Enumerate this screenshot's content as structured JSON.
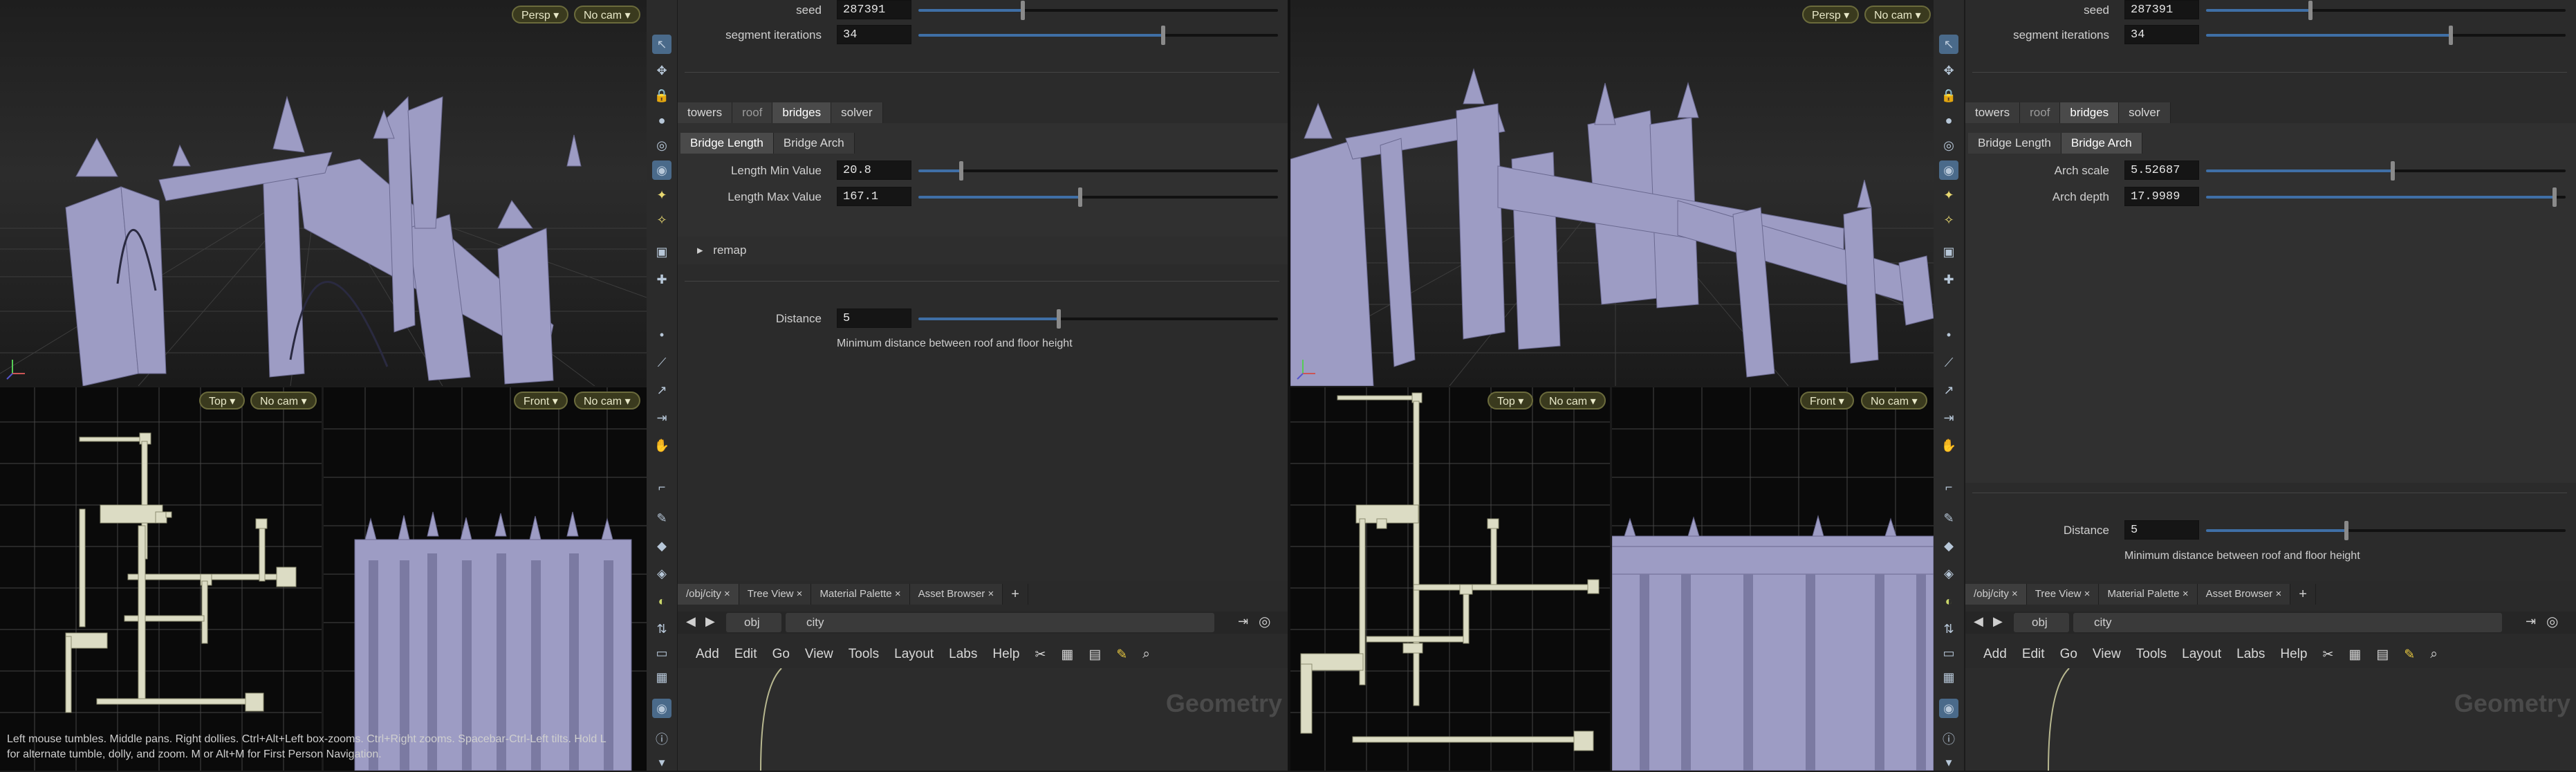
{
  "left": {
    "viewport_persp": {
      "view": "Persp",
      "cam": "No cam"
    },
    "viewport_top": {
      "view": "Top",
      "cam": "No cam"
    },
    "viewport_front": {
      "view": "Front",
      "cam": "No cam"
    },
    "status_line1": "Left mouse tumbles. Middle pans. Right dollies. Ctrl+Alt+Left box-zooms. Ctrl+Right zooms. Spacebar-Ctrl-Left tilts. Hold L",
    "status_line2": "for alternate tumble, dolly, and zoom.     M or Alt+M for First Person Navigation.",
    "params": {
      "seed_label": "seed",
      "seed_value": "287391",
      "seed_fraction": 0.29,
      "segment_label": "segment iterations",
      "segment_value": "34",
      "segment_fraction": 0.68,
      "tabs": [
        "towers",
        "roof",
        "bridges",
        "solver"
      ],
      "subtabs": [
        "Bridge Length",
        "Bridge Arch"
      ],
      "length_min_label": "Length Min Value",
      "length_min_value": "20.8",
      "length_min_fraction": 0.12,
      "length_max_label": "Length Max Value",
      "length_max_value": "167.1",
      "length_max_fraction": 0.45,
      "remap_label": "remap",
      "distance_label": "Distance",
      "distance_value": "5",
      "distance_fraction": 0.39,
      "distance_help": "Minimum distance between roof and floor height"
    },
    "pane_tabs": [
      "/obj/city",
      "Tree View",
      "Material Palette",
      "Asset Browser",
      "+"
    ],
    "path": {
      "obj": "obj",
      "city": "city"
    },
    "menu": [
      "Add",
      "Edit",
      "Go",
      "View",
      "Tools",
      "Layout",
      "Labs",
      "Help"
    ],
    "network_watermark": "Geometry"
  },
  "right": {
    "viewport_persp": {
      "view": "Persp",
      "cam": "No cam"
    },
    "viewport_top": {
      "view": "Top",
      "cam": "No cam"
    },
    "viewport_front": {
      "view": "Front",
      "cam": "No cam"
    },
    "params": {
      "seed_label": "seed",
      "seed_value": "287391",
      "seed_fraction": 0.29,
      "segment_label": "segment iterations",
      "segment_value": "34",
      "segment_fraction": 0.68,
      "tabs": [
        "towers",
        "roof",
        "bridges",
        "solver"
      ],
      "subtabs": [
        "Bridge Length",
        "Bridge Arch"
      ],
      "arch_scale_label": "Arch scale",
      "arch_scale_value": "5.52687",
      "arch_scale_fraction": 0.52,
      "arch_depth_label": "Arch depth",
      "arch_depth_value": "17.9989",
      "arch_depth_fraction": 0.97,
      "distance_label": "Distance",
      "distance_value": "5",
      "distance_fraction": 0.39,
      "distance_help": "Minimum distance between roof and floor height"
    },
    "pane_tabs": [
      "/obj/city",
      "Tree View",
      "Material Palette",
      "Asset Browser",
      "+"
    ],
    "path": {
      "obj": "obj",
      "city": "city"
    },
    "menu": [
      "Add",
      "Edit",
      "Go",
      "View",
      "Tools",
      "Layout",
      "Labs",
      "Help"
    ],
    "network_watermark": "Geometry"
  },
  "colors": {
    "geometry": "#9d9cc4",
    "grid": "#4a4a4a",
    "slider_fill": "#3f6fa6",
    "viewport_button": "#3a3a1e"
  }
}
